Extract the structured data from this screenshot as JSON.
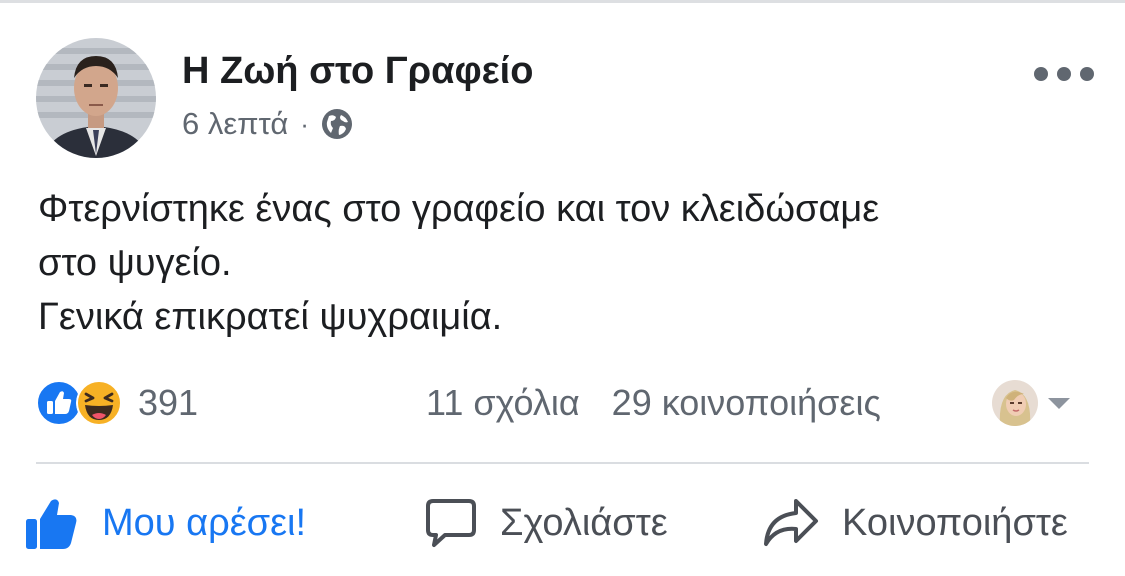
{
  "post": {
    "page_name": "Η Ζωή στο Γραφείο",
    "time": "6 λεπτά",
    "separator": "·",
    "privacy_icon": "globe-icon",
    "lines": [
      "Φτερνίστηκε ένας στο γραφείο και τον κλειδώσαμε",
      "στο ψυγείο.",
      "Γενικά επικρατεί ψυχραιμία."
    ]
  },
  "stats": {
    "reaction_icons": [
      "like-reaction-icon",
      "haha-reaction-icon"
    ],
    "reaction_count": "391",
    "comments": "11 σχόλια",
    "shares": "29 κοινοποιήσεις"
  },
  "actions": {
    "like_label": "Μου αρέσει!",
    "comment_label": "Σχολιάστε",
    "share_label": "Κοινοποιήστε"
  },
  "colors": {
    "brand_blue": "#1877f2",
    "text_primary": "#1c1e21",
    "text_secondary": "#606770",
    "haha_yellow": "#f7b125"
  }
}
